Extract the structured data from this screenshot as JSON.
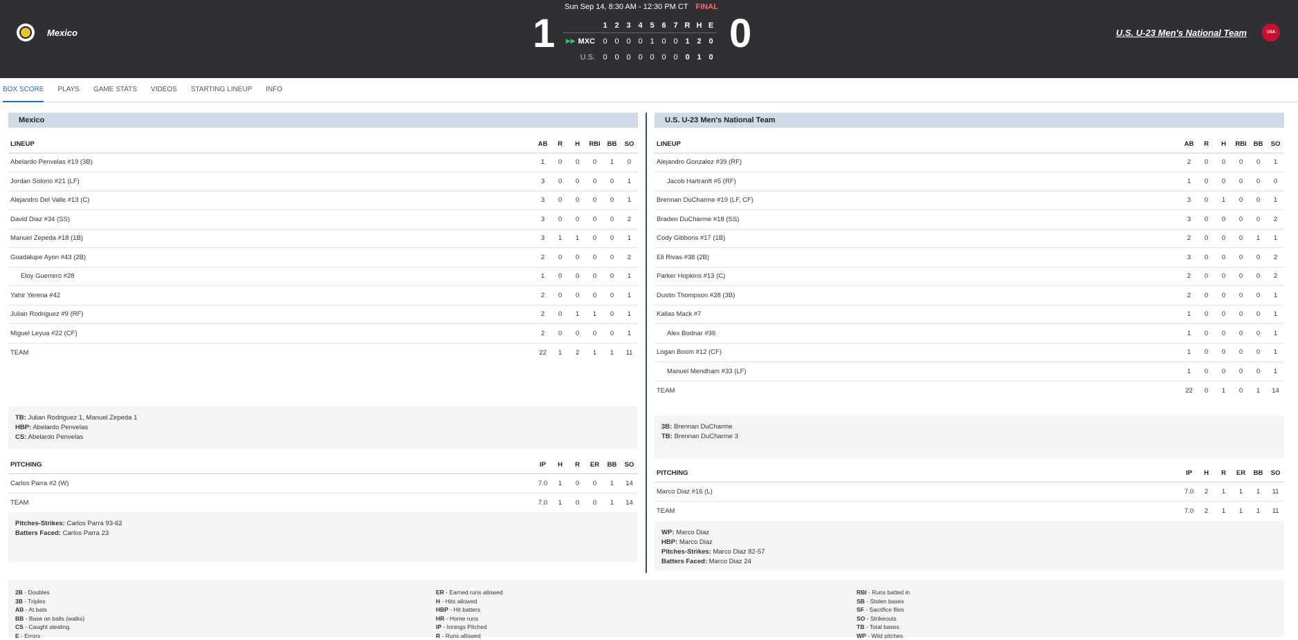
{
  "header": {
    "date": "Sun Sep 14, 8:30 AM - 12:30 PM CT",
    "status": "FINAL",
    "away_team": "Mexico",
    "home_team": "U.S. U-23 Men's National Team",
    "away_score": "1",
    "home_score": "0",
    "home_logo_text": "USA",
    "linescore": {
      "innings": [
        "1",
        "2",
        "3",
        "4",
        "5",
        "6",
        "7",
        "R",
        "H",
        "E"
      ],
      "away_abbr": "MXC",
      "away": [
        "0",
        "0",
        "0",
        "0",
        "1",
        "0",
        "0",
        "1",
        "2",
        "0"
      ],
      "home_abbr": "U.S.",
      "home": [
        "0",
        "0",
        "0",
        "0",
        "0",
        "0",
        "0",
        "0",
        "1",
        "0"
      ]
    }
  },
  "tabs": [
    "BOX SCORE",
    "PLAYS",
    "GAME STATS",
    "VIDEOS",
    "STARTING LINEUP",
    "INFO"
  ],
  "left": {
    "title": "Mexico",
    "lineup_headers": [
      "LINEUP",
      "AB",
      "R",
      "H",
      "RBI",
      "BB",
      "SO"
    ],
    "lineup": [
      {
        "name": "Abelardo Penvelas #19 (3B)",
        "sub": false,
        "stats": [
          "1",
          "0",
          "0",
          "0",
          "1",
          "0"
        ]
      },
      {
        "name": "Jordan Solorio #21 (LF)",
        "sub": false,
        "stats": [
          "3",
          "0",
          "0",
          "0",
          "0",
          "1"
        ]
      },
      {
        "name": "Alejandro Del Valle #13 (C)",
        "sub": false,
        "stats": [
          "3",
          "0",
          "0",
          "0",
          "0",
          "1"
        ]
      },
      {
        "name": "David Diaz #34 (SS)",
        "sub": false,
        "stats": [
          "3",
          "0",
          "0",
          "0",
          "0",
          "2"
        ]
      },
      {
        "name": "Manuel Zepeda #18 (1B)",
        "sub": false,
        "stats": [
          "3",
          "1",
          "1",
          "0",
          "0",
          "1"
        ]
      },
      {
        "name": "Guadalupe Ayon #43 (2B)",
        "sub": false,
        "stats": [
          "2",
          "0",
          "0",
          "0",
          "0",
          "2"
        ]
      },
      {
        "name": "Eloy Guerrero #28",
        "sub": true,
        "stats": [
          "1",
          "0",
          "0",
          "0",
          "0",
          "1"
        ]
      },
      {
        "name": "Yahir Yerena #42",
        "sub": false,
        "stats": [
          "2",
          "0",
          "0",
          "0",
          "0",
          "1"
        ]
      },
      {
        "name": "Julian Rodriguez #9 (RF)",
        "sub": false,
        "stats": [
          "2",
          "0",
          "1",
          "1",
          "0",
          "1"
        ]
      },
      {
        "name": "Miguel Leyua #22 (CF)",
        "sub": false,
        "stats": [
          "2",
          "0",
          "0",
          "0",
          "0",
          "1"
        ]
      }
    ],
    "team_label": "TEAM",
    "team_stats": [
      "22",
      "1",
      "2",
      "1",
      "1",
      "11"
    ],
    "bat_notes": [
      {
        "k": "TB:",
        "v": " Julian Rodriguez 1, Manuel Zepeda 1"
      },
      {
        "k": "HBP:",
        "v": " Abelardo Penvelas"
      },
      {
        "k": "CS:",
        "v": " Abelardo Penvelas"
      }
    ],
    "pitch_headers": [
      "PITCHING",
      "IP",
      "H",
      "R",
      "ER",
      "BB",
      "SO"
    ],
    "pitching": [
      {
        "name": "Carlos Parra #2 (W)",
        "stats": [
          "7.0",
          "1",
          "0",
          "0",
          "1",
          "14"
        ]
      }
    ],
    "pitch_team": [
      "7.0",
      "1",
      "0",
      "0",
      "1",
      "14"
    ],
    "pitch_notes": [
      {
        "k": "Pitches-Strikes:",
        "v": " Carlos Parra 93-62"
      },
      {
        "k": "Batters Faced:",
        "v": " Carlos Parra 23"
      }
    ]
  },
  "right": {
    "title": "U.S. U-23 Men's National Team",
    "lineup_headers": [
      "LINEUP",
      "AB",
      "R",
      "H",
      "RBI",
      "BB",
      "SO"
    ],
    "lineup": [
      {
        "name": "Alejandro Gonzalez #39 (RF)",
        "sub": false,
        "stats": [
          "2",
          "0",
          "0",
          "0",
          "0",
          "1"
        ]
      },
      {
        "name": "Jacob Hartranft #5 (RF)",
        "sub": true,
        "stats": [
          "1",
          "0",
          "0",
          "0",
          "0",
          "0"
        ]
      },
      {
        "name": "Brennan DuCharme #19 (LF, CF)",
        "sub": false,
        "stats": [
          "3",
          "0",
          "1",
          "0",
          "0",
          "1"
        ]
      },
      {
        "name": "Braden DuCharme #18 (SS)",
        "sub": false,
        "stats": [
          "3",
          "0",
          "0",
          "0",
          "0",
          "2"
        ]
      },
      {
        "name": "Cody Gibbons #17 (1B)",
        "sub": false,
        "stats": [
          "2",
          "0",
          "0",
          "0",
          "1",
          "1"
        ]
      },
      {
        "name": "Eli Rivas #38 (2B)",
        "sub": false,
        "stats": [
          "3",
          "0",
          "0",
          "0",
          "0",
          "2"
        ]
      },
      {
        "name": "Parker Hopkins #13 (C)",
        "sub": false,
        "stats": [
          "2",
          "0",
          "0",
          "0",
          "0",
          "2"
        ]
      },
      {
        "name": "Dustin Thompson #28 (3B)",
        "sub": false,
        "stats": [
          "2",
          "0",
          "0",
          "0",
          "0",
          "1"
        ]
      },
      {
        "name": "Kallas Mack #7",
        "sub": false,
        "stats": [
          "1",
          "0",
          "0",
          "0",
          "0",
          "1"
        ]
      },
      {
        "name": "Alex Bodnar #36",
        "sub": true,
        "stats": [
          "1",
          "0",
          "0",
          "0",
          "0",
          "1"
        ]
      },
      {
        "name": "Logan Boom #12 (CF)",
        "sub": false,
        "stats": [
          "1",
          "0",
          "0",
          "0",
          "0",
          "1"
        ]
      },
      {
        "name": "Manuel Mendham #33 (LF)",
        "sub": true,
        "stats": [
          "1",
          "0",
          "0",
          "0",
          "0",
          "1"
        ]
      }
    ],
    "team_label": "TEAM",
    "team_stats": [
      "22",
      "0",
      "1",
      "0",
      "1",
      "14"
    ],
    "bat_notes": [
      {
        "k": "3B:",
        "v": " Brennan DuCharme"
      },
      {
        "k": "TB:",
        "v": " Brennan DuCharme 3"
      }
    ],
    "pitch_headers": [
      "PITCHING",
      "IP",
      "H",
      "R",
      "ER",
      "BB",
      "SO"
    ],
    "pitching": [
      {
        "name": "Marco Diaz #16 (L)",
        "stats": [
          "7.0",
          "2",
          "1",
          "1",
          "1",
          "11"
        ]
      }
    ],
    "pitch_team": [
      "7.0",
      "2",
      "1",
      "1",
      "1",
      "11"
    ],
    "pitch_notes": [
      {
        "k": "WP:",
        "v": " Marco Diaz"
      },
      {
        "k": "HBP:",
        "v": " Marco Diaz"
      },
      {
        "k": "Pitches-Strikes:",
        "v": " Marco Diaz 82-57"
      },
      {
        "k": "Batters Faced:",
        "v": " Marco Diaz 24"
      }
    ]
  },
  "legend": [
    [
      {
        "k": "2B",
        "v": " - Doubles"
      },
      {
        "k": "3B",
        "v": " - Triples"
      },
      {
        "k": "AB",
        "v": " - At bats"
      },
      {
        "k": "BB",
        "v": " - Base on balls (walks)"
      },
      {
        "k": "CS",
        "v": " - Caught stealing"
      },
      {
        "k": "E",
        "v": " - Errors"
      }
    ],
    [
      {
        "k": "ER",
        "v": " - Earned runs allowed"
      },
      {
        "k": "H",
        "v": " - Hits allowed"
      },
      {
        "k": "HBP",
        "v": " - Hit batters"
      },
      {
        "k": "HR",
        "v": " - Home runs"
      },
      {
        "k": "IP",
        "v": " - Innings Pitched"
      },
      {
        "k": "R",
        "v": " - Runs allowed"
      }
    ],
    [
      {
        "k": "RBI",
        "v": " - Runs batted in"
      },
      {
        "k": "SB",
        "v": " - Stolen bases"
      },
      {
        "k": "SF",
        "v": " - Sacrifice files"
      },
      {
        "k": "SO",
        "v": " - Strikeouts"
      },
      {
        "k": "TB",
        "v": " - Total bases"
      },
      {
        "k": "WP",
        "v": " - Wild pitches"
      }
    ]
  ]
}
